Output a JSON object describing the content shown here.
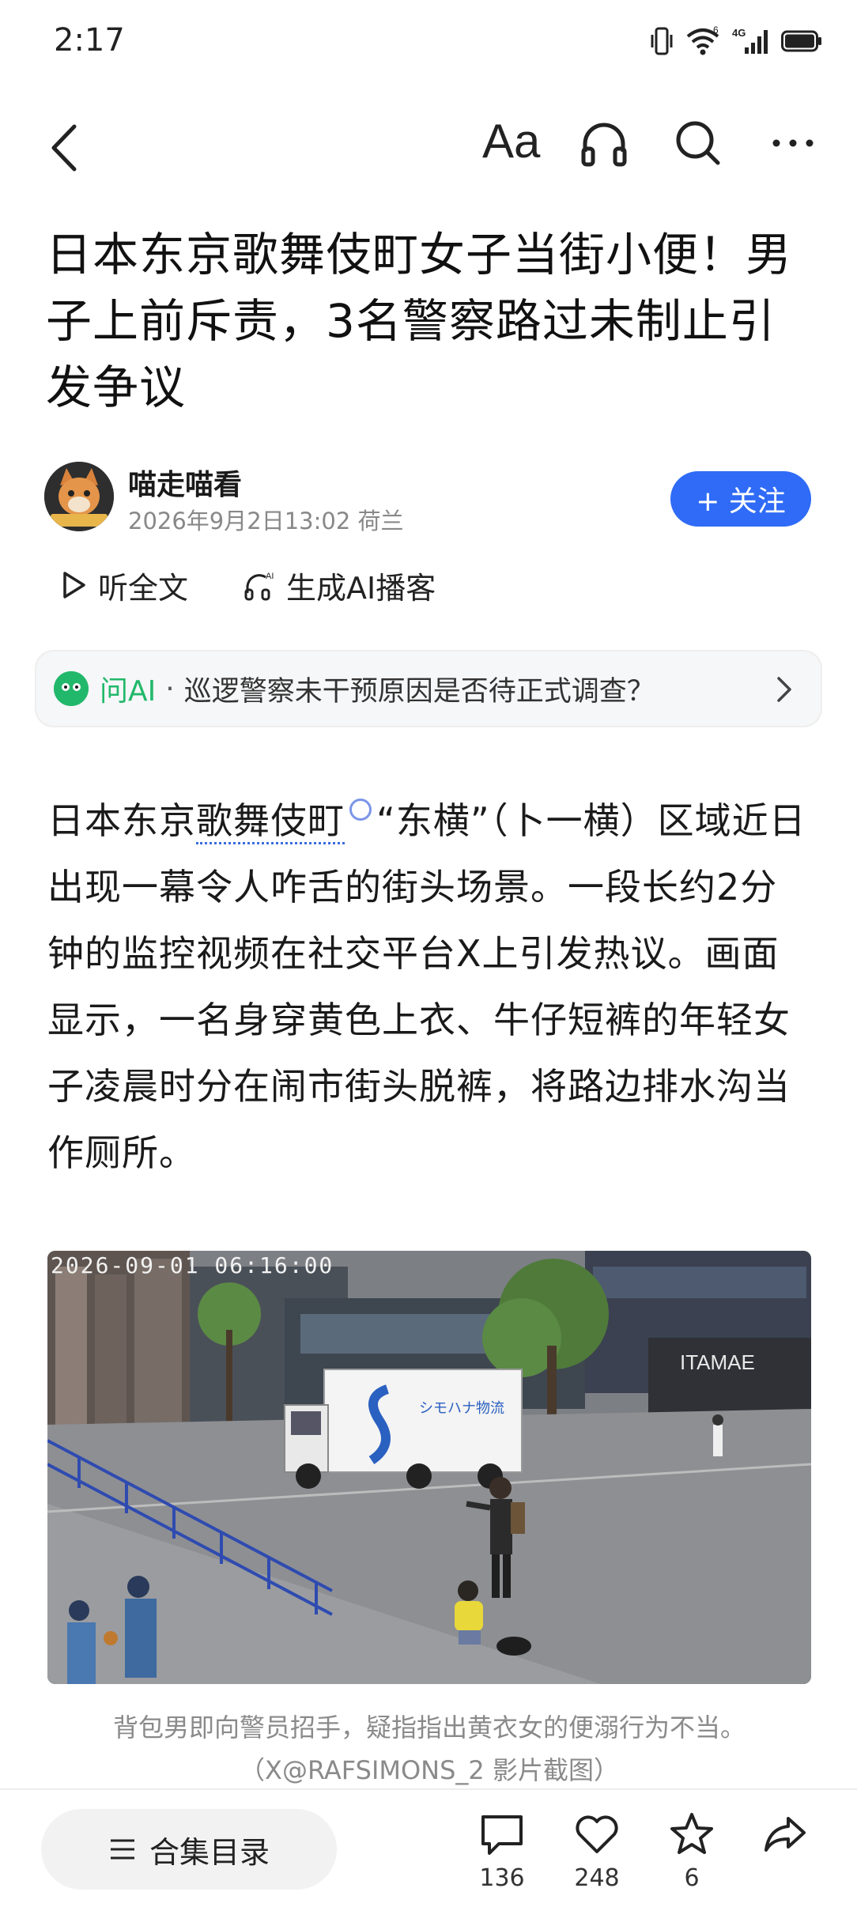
{
  "status_bar": {
    "time": "2:17",
    "signal_label": "4G",
    "wifi_label": "6"
  },
  "nav": {
    "font_size_label": "Aa"
  },
  "article": {
    "title": "日本东京歌舞伎町女子当街小便！男子上前斥责，3名警察路过未制止引发争议",
    "author": "喵走喵看",
    "meta": "2026年9月2日13:02 荷兰",
    "follow_label": "+ 关注",
    "listen_full": "听全文",
    "generate_podcast": "生成AI播客",
    "ask_ai_label": "问AI",
    "ask_ai_question": "巡逻警察未干预原因是否待正式调查？",
    "para_link": "歌舞伎町",
    "para_before": "日本东京",
    "para_after": "“东横”（卜一横）区域近日出现一幕令人咋舌的街头场景。一段长约2分钟的监控视频在社交平台X上引发热议。画面显示，一名身穿黄色上衣、牛仔短裤的年轻女子凌晨时分在闹市街头脱裤，将路边排水沟当作厕所。",
    "photo_timestamp": "2026-09-01 06:16:00",
    "truck_text": "シモハナ物流",
    "store_text": "ITAMAE",
    "caption_line1": "背包男即向警员招手，疑指指出黄衣女的便溺行为不当。",
    "caption_line2": "（X@RAFSIMONS_2 影片截图）"
  },
  "bottom_bar": {
    "collection_label": "合集目录",
    "comments": "136",
    "likes": "248",
    "favorites": "6"
  },
  "colors": {
    "accent_blue": "#2f6bf6",
    "ai_green": "#22b86b"
  }
}
